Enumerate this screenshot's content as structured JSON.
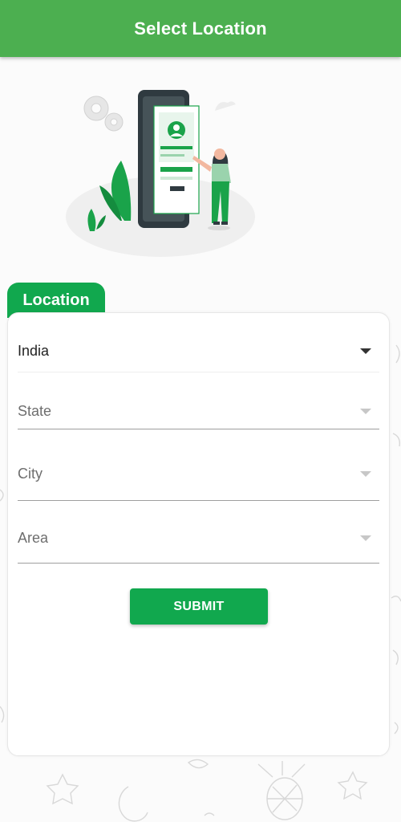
{
  "app_bar": {
    "title": "Select Location"
  },
  "section": {
    "tab_label": "Location"
  },
  "form": {
    "country": {
      "value": "India"
    },
    "state": {
      "placeholder": "State"
    },
    "city": {
      "placeholder": "City"
    },
    "area": {
      "placeholder": "Area"
    },
    "submit_label": "SUBMIT"
  },
  "colors": {
    "app_bar": "#4caf50",
    "accent": "#11a84e",
    "background": "#fbfbfb"
  },
  "icons": {
    "dropdown": "chevron-down-icon"
  }
}
